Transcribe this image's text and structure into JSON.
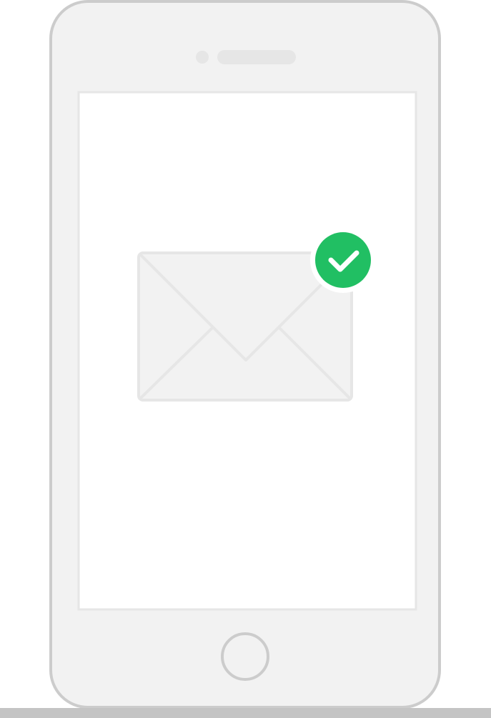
{
  "illustration": {
    "subject": "smartphone-with-envelope",
    "icons": {
      "envelope": "envelope-icon",
      "badge": "check-circle-icon",
      "home_button": "home-button-icon"
    },
    "colors": {
      "phone_body": "#f2f2f2",
      "phone_outline": "#cccccc",
      "screen": "#ffffff",
      "screen_border": "#e6e6e6",
      "envelope_fill": "#f2f2f2",
      "envelope_lines": "#e6e6e6",
      "badge_green": "#21bf63",
      "badge_ring": "#ffffff",
      "checkmark": "#ffffff",
      "ground": "#c4c4c4"
    },
    "status": "sent"
  }
}
